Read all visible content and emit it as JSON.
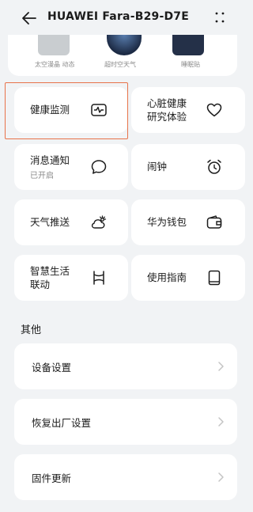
{
  "header": {
    "title": "HUAWEI Fara-B29-D7E"
  },
  "dials": [
    {
      "label": "太空漫晶 动态"
    },
    {
      "label": "超时空天气"
    },
    {
      "label": "睡眠贴"
    }
  ],
  "features": [
    {
      "label": "健康监测",
      "icon": "heartbeat-monitor-icon"
    },
    {
      "label": "心脏健康研究体验",
      "line1": "心脏健康",
      "line2": "研究体验",
      "icon": "heart-icon"
    },
    {
      "label": "消息通知",
      "sub": "已开启",
      "icon": "chat-bubble-icon"
    },
    {
      "label": "闹钟",
      "icon": "alarm-clock-icon"
    },
    {
      "label": "天气推送",
      "icon": "weather-icon"
    },
    {
      "label": "华为钱包",
      "icon": "wallet-icon"
    },
    {
      "label": "智慧生活联动",
      "line1": "智慧生活",
      "line2": "联动",
      "icon": "smart-life-icon"
    },
    {
      "label": "使用指南",
      "icon": "guide-book-icon"
    }
  ],
  "other": {
    "title": "其他",
    "items": [
      {
        "label": "设备设置"
      },
      {
        "label": "恢复出厂设置"
      },
      {
        "label": "固件更新"
      }
    ]
  },
  "colors": {
    "highlight": "#e8734a",
    "background": "#f1f3f5",
    "card": "#ffffff"
  }
}
